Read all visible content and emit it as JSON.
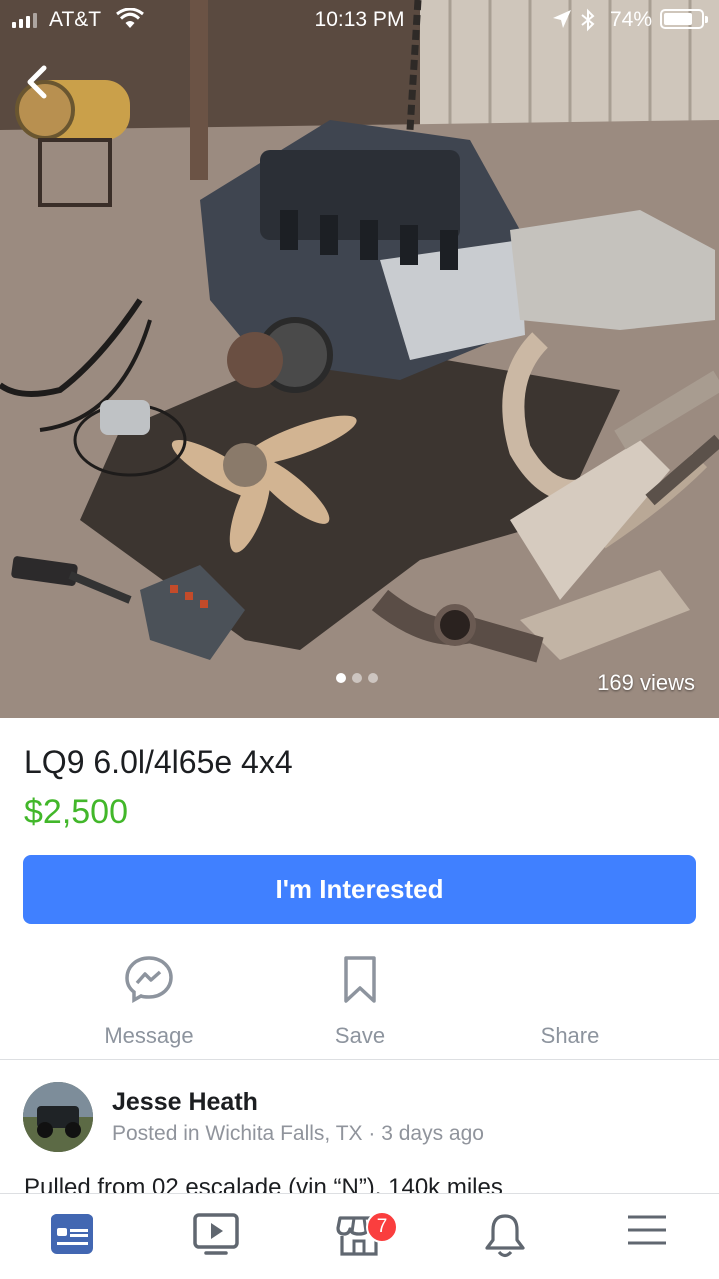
{
  "status_bar": {
    "carrier": "AT&T",
    "time": "10:13 PM",
    "battery_percent": "74%"
  },
  "photo": {
    "views": "169 views",
    "carousel_total": 3,
    "carousel_active": 1
  },
  "listing": {
    "title": "LQ9 6.0l/4l65e 4x4",
    "price": "$2,500",
    "cta_label": "I'm Interested",
    "description": "Pulled from 02 escalade (vin “N”). 140k miles"
  },
  "actions": {
    "message": "Message",
    "save": "Save",
    "share": "Share"
  },
  "seller": {
    "name": "Jesse Heath",
    "meta": "Posted in Wichita Falls, TX · 3 days ago"
  },
  "tabbar": {
    "marketplace_badge": "7",
    "active_color": "#4267b2"
  },
  "colors": {
    "accent_blue": "#4080ff",
    "price_green": "#42b72a",
    "badge_red": "#fa3e3e",
    "muted_gray": "#8d949e"
  }
}
